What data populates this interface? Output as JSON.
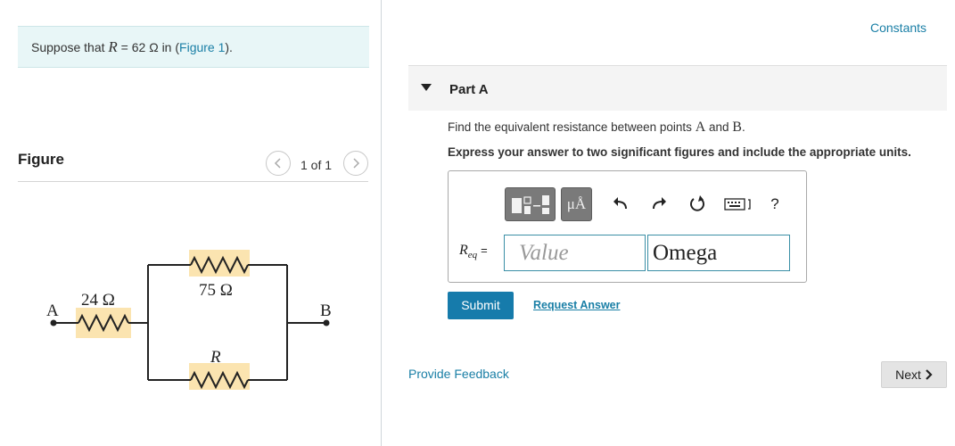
{
  "problem": {
    "prefix": "Suppose that ",
    "var": "R",
    "middle": " = 62 Ω in (",
    "figure_link": "Figure 1",
    "suffix": ")."
  },
  "figure": {
    "title": "Figure",
    "pager": "1 of 1",
    "prev_icon": "chevron-left-icon",
    "next_icon": "chevron-right-icon",
    "circuit": {
      "left_node": "A",
      "right_node": "B",
      "series_resistor": "24 Ω",
      "top_resistor": "75 Ω",
      "bottom_resistor": "R"
    }
  },
  "header": {
    "constants": "Constants"
  },
  "part": {
    "label": "Part A",
    "question_prefix": "Find the equivalent resistance between points ",
    "point_a": "A",
    "question_and": " and ",
    "point_b": "B",
    "question_end": ".",
    "instruction": "Express your answer to two significant figures and include the appropriate units."
  },
  "answer": {
    "symbol_main": "R",
    "symbol_sub": "eq",
    "equals": "=",
    "value_placeholder": "Value",
    "unit_value": "Omega",
    "toolbar": {
      "templates_icon": "templates-icon",
      "units_button": "μÅ",
      "undo_icon": "undo-icon",
      "redo_icon": "redo-icon",
      "reset_icon": "reset-icon",
      "keyboard_icon": "keyboard-icon",
      "help": "?"
    }
  },
  "actions": {
    "submit": "Submit",
    "request_answer": "Request Answer",
    "provide_feedback": "Provide Feedback",
    "next": "Next"
  },
  "colors": {
    "accent": "#167bab",
    "link": "#1a7fa6",
    "problem_bg": "#e8f6f7",
    "resistor_highlight": "#fbe4b0"
  }
}
